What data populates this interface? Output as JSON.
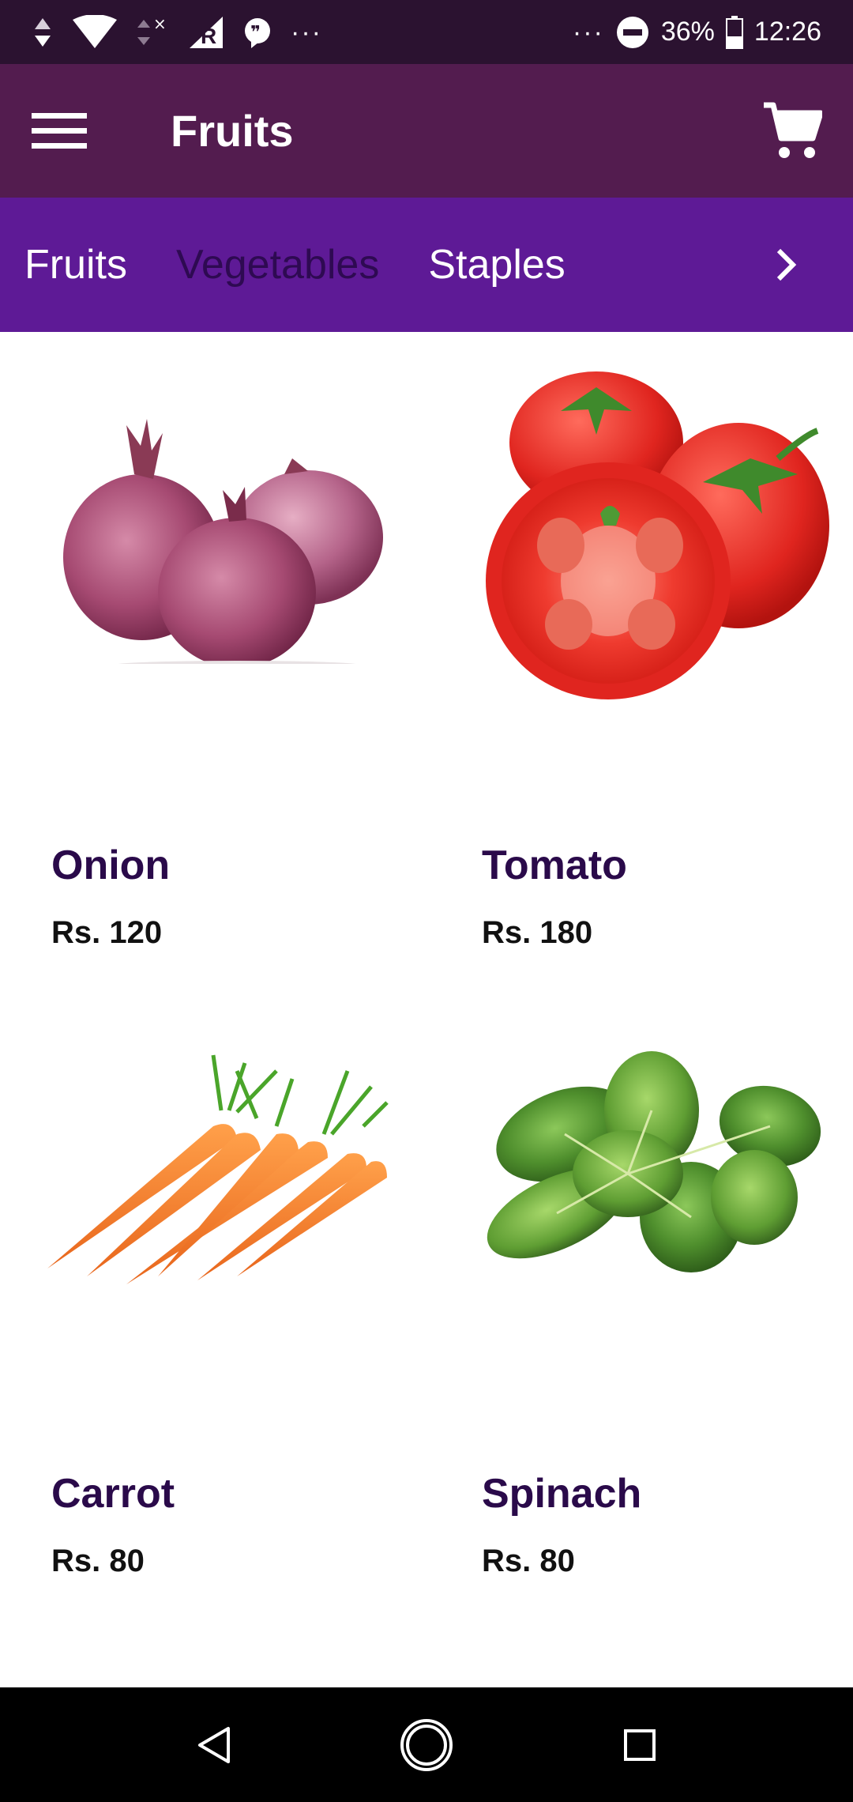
{
  "status_bar": {
    "left_dots": "···",
    "right_dots": "···",
    "battery": "36%",
    "time": "12:26",
    "icons": [
      "data-arrows-icon",
      "wifi-icon",
      "signal-arrows-icon",
      "no-signal-icon",
      "roaming-signal-icon",
      "chat-bubble-icon",
      "do-not-disturb-icon",
      "battery-icon"
    ]
  },
  "app_bar": {
    "title": "Fruits",
    "menu_icon": "hamburger-menu-icon",
    "cart_icon": "shopping-cart-icon"
  },
  "tabs": {
    "items": [
      {
        "label": "Fruits",
        "selected": false
      },
      {
        "label": "Vegetables",
        "selected": true
      },
      {
        "label": "Staples",
        "selected": false
      }
    ],
    "next_icon": "chevron-right-icon"
  },
  "products": [
    {
      "name": "Onion",
      "price": "Rs. 120",
      "image": "onion-image"
    },
    {
      "name": "Tomato",
      "price": "Rs. 180",
      "image": "tomato-image"
    },
    {
      "name": "Carrot",
      "price": "Rs. 80",
      "image": "carrot-image"
    },
    {
      "name": "Spinach",
      "price": "Rs. 80",
      "image": "spinach-image"
    }
  ],
  "nav_bar": {
    "icons": [
      "back-icon",
      "home-icon",
      "recents-icon"
    ]
  },
  "colors": {
    "status_bar": "#2b1230",
    "app_bar": "#531c4f",
    "tab_bar": "#5e1a96",
    "tab_selected_text": "#2e0a52",
    "product_name": "#2a0a4a",
    "nav_bar": "#000000"
  }
}
